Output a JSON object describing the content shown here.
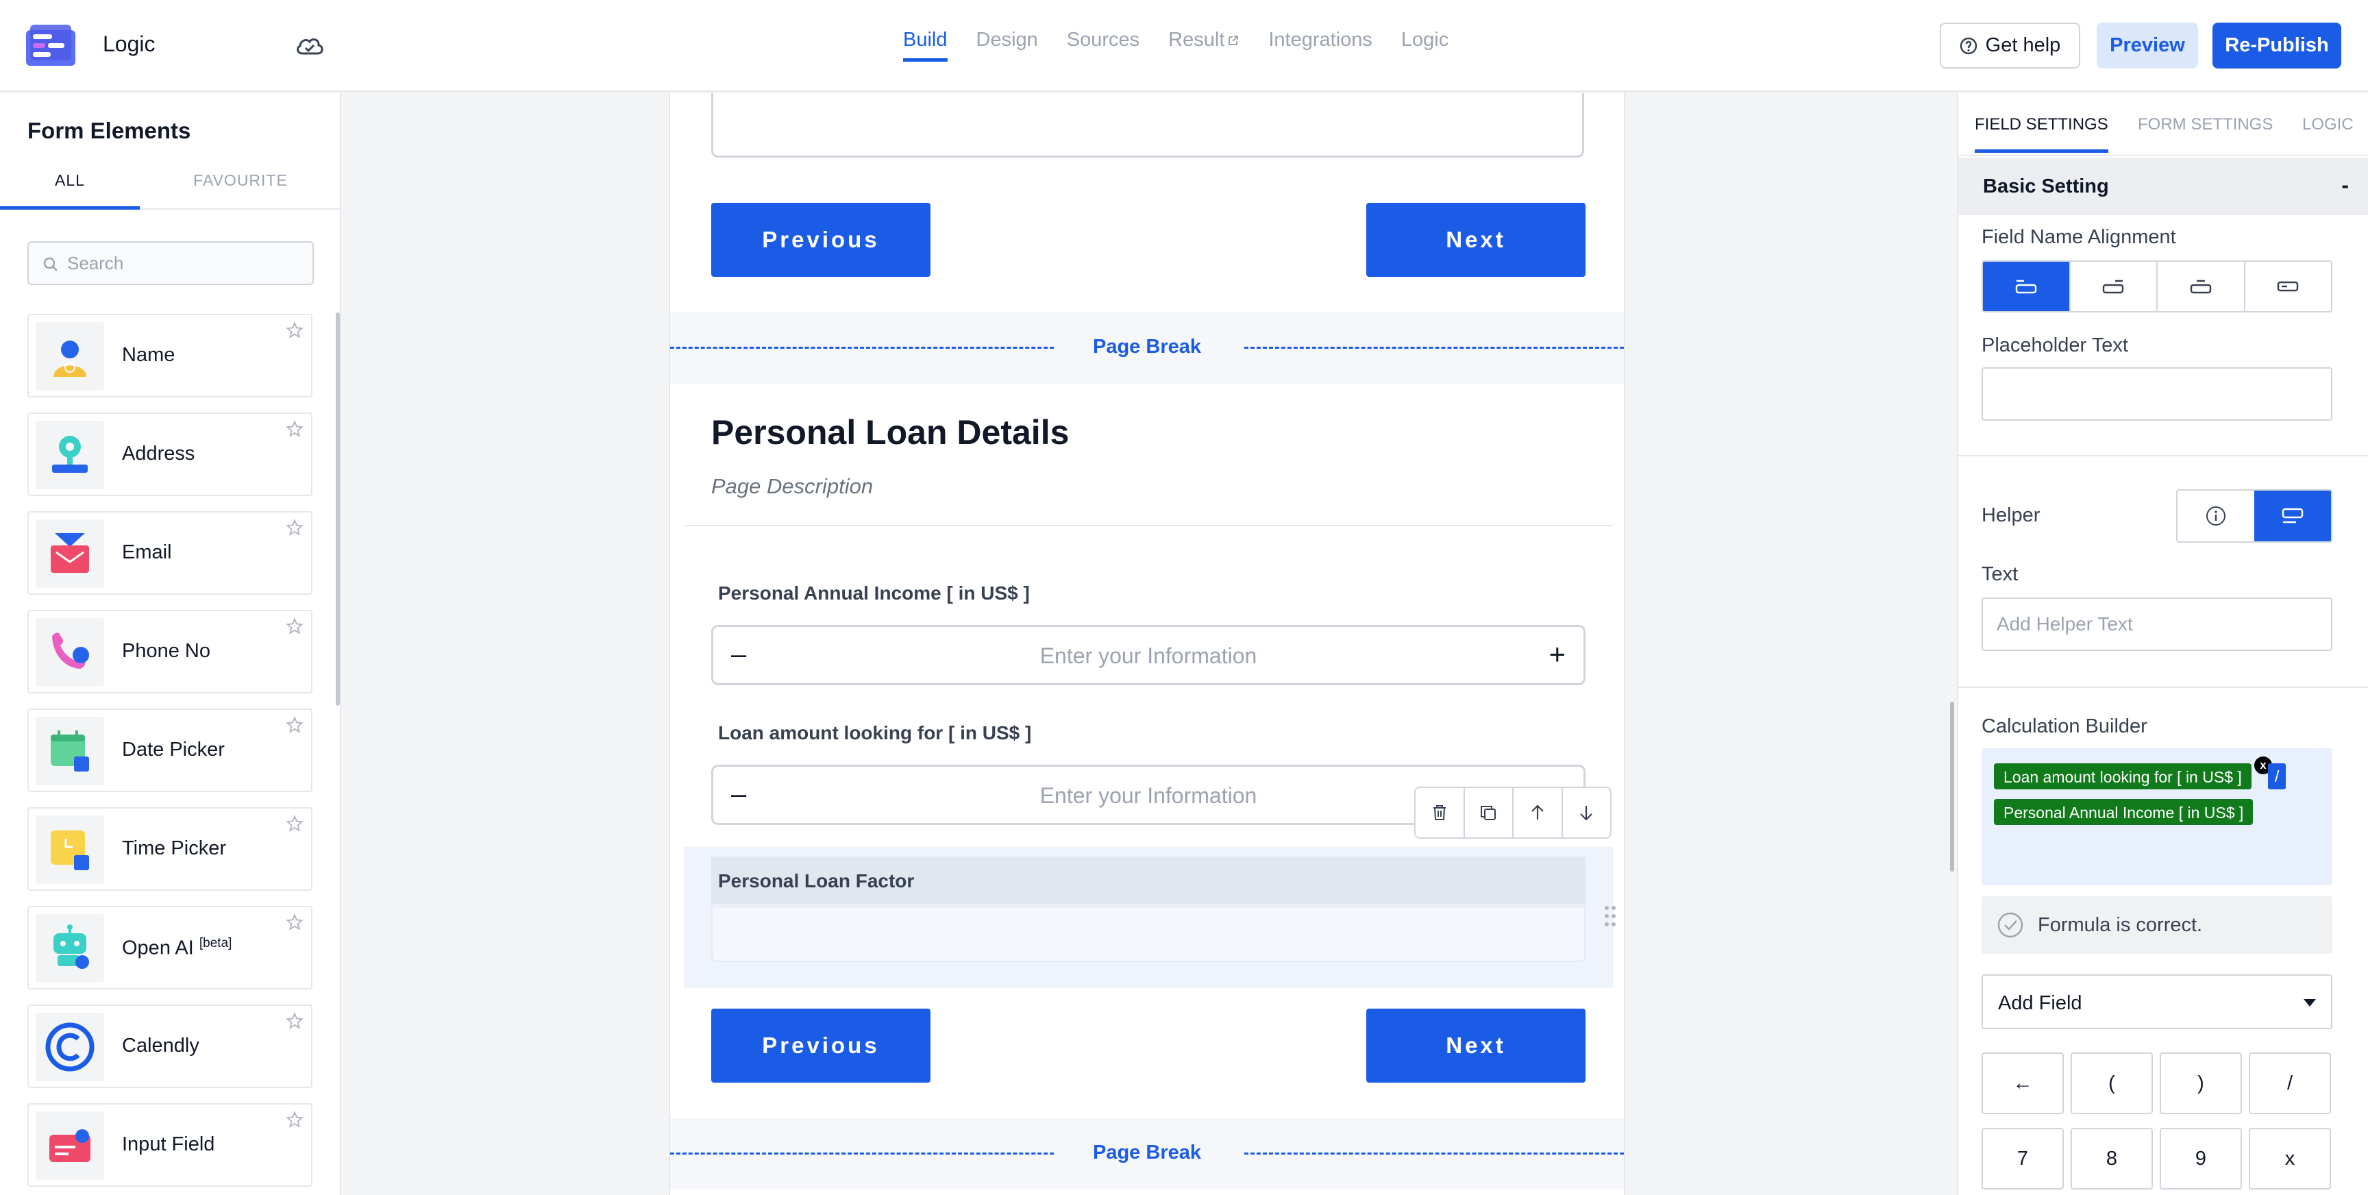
{
  "app": {
    "title": "Logic"
  },
  "nav": {
    "tabs": [
      {
        "label": "Build",
        "active": true
      },
      {
        "label": "Design"
      },
      {
        "label": "Sources"
      },
      {
        "label": "Result"
      },
      {
        "label": "Integrations"
      },
      {
        "label": "Logic"
      }
    ]
  },
  "header": {
    "help_label": "Get help",
    "preview_label": "Preview",
    "republish_label": "Re-Publish"
  },
  "sidebar": {
    "title": "Form Elements",
    "tabs": {
      "all": "ALL",
      "favourite": "FAVOURITE"
    },
    "search_placeholder": "Search",
    "items": [
      {
        "label": "Name",
        "icon": "person-icon"
      },
      {
        "label": "Address",
        "icon": "location-icon"
      },
      {
        "label": "Email",
        "icon": "envelope-icon"
      },
      {
        "label": "Phone No",
        "icon": "phone-icon"
      },
      {
        "label": "Date Picker",
        "icon": "calendar-icon"
      },
      {
        "label": "Time Picker",
        "icon": "clock-icon"
      },
      {
        "label": "Open AI",
        "badge": "[beta]",
        "icon": "robot-icon"
      },
      {
        "label": "Calendly",
        "icon": "calendly-icon"
      },
      {
        "label": "Input Field",
        "icon": "input-field-icon"
      }
    ]
  },
  "canvas": {
    "prev_label": "Previous",
    "next_label": "Next",
    "page_break_label": "Page Break",
    "page_title": "Personal Loan Details",
    "page_description": "Page Description",
    "fields": [
      {
        "label": "Personal Annual Income  [ in US$ ]",
        "placeholder": "Enter your Information"
      },
      {
        "label": "Loan amount looking for  [ in US$ ]",
        "placeholder": "Enter your Information"
      }
    ],
    "selected_field_label": "Personal Loan Factor",
    "minus_symbol": "–",
    "plus_symbol": "+"
  },
  "right_panel": {
    "tabs": [
      "FIELD SETTINGS",
      "FORM SETTINGS",
      "LOGIC"
    ],
    "section_title": "Basic Setting",
    "collapse_symbol": "-",
    "field_name_alignment_label": "Field Name Alignment",
    "placeholder_text_label": "Placeholder Text",
    "placeholder_text_value": "",
    "helper_label": "Helper",
    "text_label": "Text",
    "helper_text_placeholder": "Add Helper Text",
    "calculation_builder_label": "Calculation Builder",
    "formula_tokens": [
      {
        "type": "field",
        "label": "Loan amount looking for  [ in US$ ]"
      },
      {
        "type": "operator",
        "label": "/"
      },
      {
        "type": "field",
        "label": "Personal Annual Income  [ in US$ ]"
      }
    ],
    "remove_symbol": "x",
    "formula_status": "Formula is correct.",
    "add_field_label": "Add Field",
    "keypad": [
      "←",
      "(",
      ")",
      "/",
      "7",
      "8",
      "9",
      "x"
    ]
  },
  "colors": {
    "accent": "#1a5ce6",
    "accent_light": "#dbe7fb",
    "field_chip": "#117a1a",
    "calc_background": "#e8f0fd"
  }
}
